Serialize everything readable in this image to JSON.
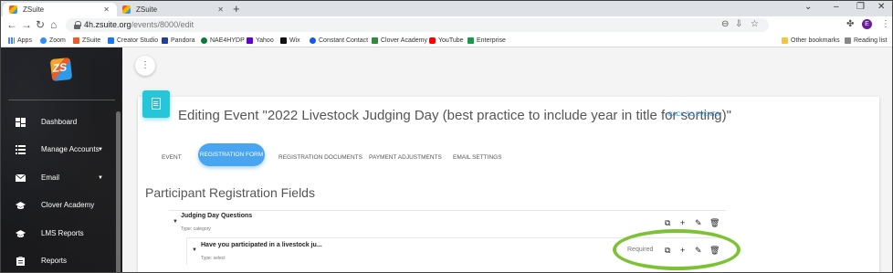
{
  "browser": {
    "tabs": [
      {
        "title": "ZSuite",
        "active": true
      },
      {
        "title": "ZSuite",
        "active": false
      }
    ],
    "new_tab": "+",
    "window_controls": [
      "⌄",
      "–",
      "❐",
      "✕"
    ],
    "nav": {
      "back": "←",
      "forward": "→",
      "reload": "↻",
      "home": "⌂"
    },
    "url_host": "4h.zsuite.org",
    "url_path": "/events/8000/edit",
    "profile_initial": "E",
    "bookmarks": [
      {
        "label": "Apps",
        "color": "#4285f4"
      },
      {
        "label": "Zoom",
        "color": "#2d8cff"
      },
      {
        "label": "ZSuite",
        "color": "#e85c2c"
      },
      {
        "label": "Creator Studio",
        "color": "#1877f2"
      },
      {
        "label": "Pandora",
        "color": "#224099"
      },
      {
        "label": "NAE4HYDP",
        "color": "#0a7d3b"
      },
      {
        "label": "Yahoo",
        "color": "#6001d2"
      },
      {
        "label": "Wix",
        "color": "#111111"
      },
      {
        "label": "Constant Contact",
        "color": "#1856ed"
      },
      {
        "label": "Clover Academy",
        "color": "#2e8b3a"
      },
      {
        "label": "YouTube",
        "color": "#ff0000"
      },
      {
        "label": "Enterprise",
        "color": "#169b4a"
      }
    ],
    "other_bookmarks": "Other bookmarks",
    "reading_list": "Reading list"
  },
  "sidebar": {
    "logo_text": "ZS",
    "items": [
      {
        "label": "Dashboard",
        "icon": "dashboard-icon",
        "has_caret": false
      },
      {
        "label": "Manage Accounts",
        "icon": "list-icon",
        "has_caret": true
      },
      {
        "label": "Email",
        "icon": "mail-icon",
        "has_caret": true
      },
      {
        "label": "Clover Academy",
        "icon": "graduation-cap-icon",
        "has_caret": false
      },
      {
        "label": "LMS Reports",
        "icon": "graduation-cap-icon",
        "has_caret": false
      },
      {
        "label": "Reports",
        "icon": "clipboard-icon",
        "has_caret": false
      }
    ]
  },
  "main": {
    "kebab": "⋮",
    "title": "Editing Event \"2022 Livestock Judging Day (best practice to include year in title for sorting)\"",
    "back_link": "‹  BACK TO EVENTS",
    "tabs": [
      {
        "label": "EVENT",
        "active": false
      },
      {
        "label": "REGISTRATION FORM",
        "active": true
      },
      {
        "label": "REGISTRATION DOCUMENTS",
        "active": false
      },
      {
        "label": "PAYMENT ADJUSTMENTS",
        "active": false
      },
      {
        "label": "EMAIL SETTINGS",
        "active": false
      }
    ],
    "section_title": "Participant Registration Fields",
    "category_row": {
      "title": "Judging Day Questions",
      "subtitle": "Type: category"
    },
    "question_row": {
      "title": "Have you participated in a livestock ju...",
      "subtitle": "Type: select",
      "required": "Required"
    },
    "action_icons": {
      "copy": "⧉",
      "add": "+",
      "edit": "✎",
      "delete": "🗑"
    }
  },
  "colors": {
    "accent": "#4aa5f0",
    "card_icon": "#26c6da",
    "highlight": "#7dc234",
    "link": "#1e88e5"
  }
}
